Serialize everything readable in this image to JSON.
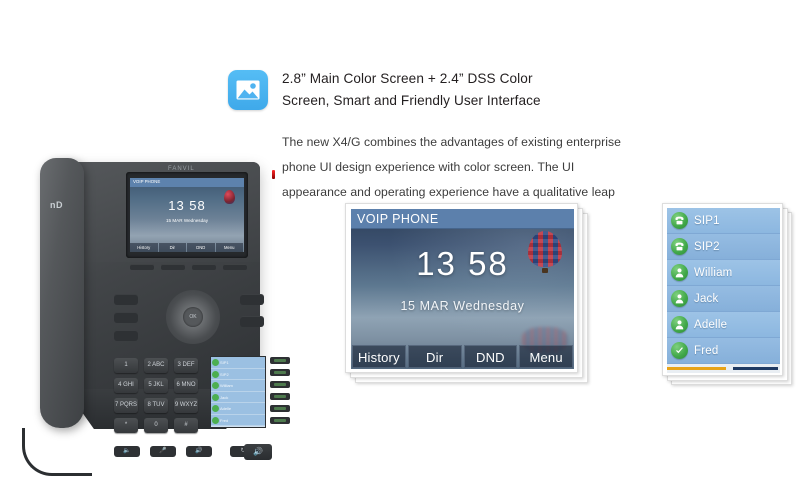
{
  "feature": {
    "icon_name": "image-icon",
    "icon_color": "#4FB3F0",
    "title_line1": "2.8” Main Color Screen + 2.4” DSS Color",
    "title_line2": "Screen, Smart and Friendly User Interface",
    "body_line1": "The new X4/G combines the advantages of existing enterprise",
    "body_line2": "phone UI design experience with color screen. The UI",
    "body_line3": "appearance and operating experience have a qualitative leap"
  },
  "phone_photo": {
    "brand": "FANVIL",
    "handset_logo": "nD",
    "screen": {
      "header": "VOIP PHONE",
      "time": "13 58",
      "date": "15 MAR Wednesday",
      "softkeys": [
        "History",
        "Dir",
        "DND",
        "Menu"
      ]
    },
    "keypad": [
      "1",
      "2 ABC",
      "3 DEF",
      "4 GHI",
      "5 JKL",
      "6 MNO",
      "7 PQRS",
      "8 TUV",
      "9 WXYZ",
      "*",
      "0",
      "#"
    ],
    "dss_labels": [
      "SIP1",
      "SIP2",
      "William",
      "Jack",
      "Adelle",
      "Fred"
    ],
    "bottom_buttons": [
      "headset",
      "mute",
      "speaker-volume"
    ],
    "ok_label": "OK"
  },
  "main_screen": {
    "header": "VOIP  PHONE",
    "time": "13 58",
    "date": "15  MAR  Wednesday",
    "softkeys": [
      {
        "label": "History"
      },
      {
        "label": "Dir"
      },
      {
        "label": "DND"
      },
      {
        "label": "Menu"
      }
    ],
    "header_color": "#5C80AC",
    "decor": "hot-air-balloon"
  },
  "dss_screen": {
    "rows": [
      {
        "label": "SIP1",
        "icon": "telephone-icon",
        "icon_color": "#41A849"
      },
      {
        "label": "SIP2",
        "icon": "telephone-icon",
        "icon_color": "#41A849"
      },
      {
        "label": "William",
        "icon": "person-icon",
        "icon_color": "#41A849"
      },
      {
        "label": "Jack",
        "icon": "person-icon",
        "icon_color": "#41A849"
      },
      {
        "label": "Adelle",
        "icon": "person-icon",
        "icon_color": "#41A849"
      },
      {
        "label": "Fred",
        "icon": "check-icon",
        "icon_color": "#41A849"
      }
    ],
    "indicator_left_color": "#E8A317",
    "indicator_right_color": "#1F3A63"
  }
}
